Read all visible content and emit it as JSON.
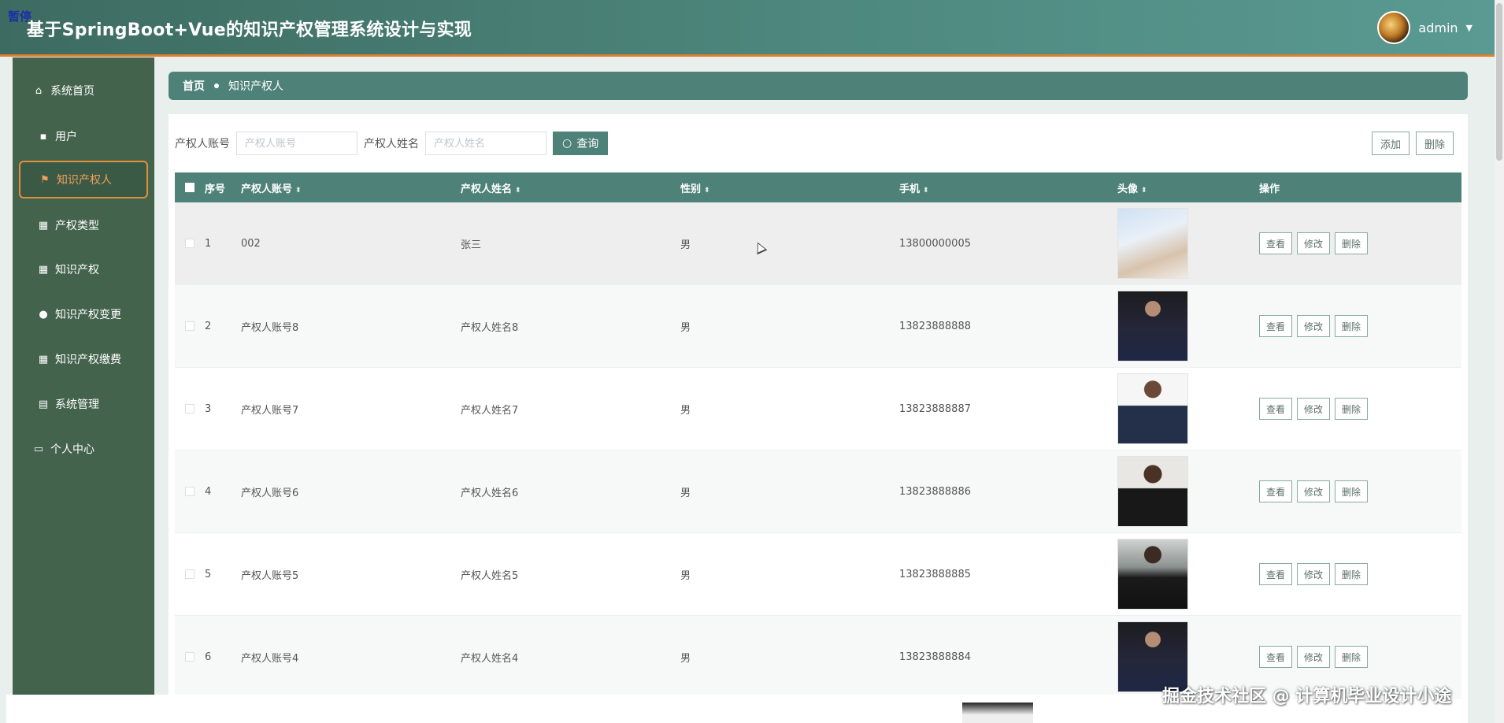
{
  "header": {
    "overlay": "暂停",
    "title": "基于SpringBoot+Vue的知识产权管理系统设计与实现",
    "user": "admin"
  },
  "sidebar": {
    "items": [
      {
        "label": "系统首页",
        "icon": "home-icon"
      },
      {
        "label": "用户",
        "icon": "chat-icon"
      },
      {
        "label": "知识产权人",
        "icon": "flag-icon"
      },
      {
        "label": "产权类型",
        "icon": "grid-icon"
      },
      {
        "label": "知识产权",
        "icon": "grid-icon"
      },
      {
        "label": "知识产权变更",
        "icon": "location-icon"
      },
      {
        "label": "知识产权缴费",
        "icon": "grid-icon"
      },
      {
        "label": "系统管理",
        "icon": "table-icon"
      },
      {
        "label": "个人中心",
        "icon": "calendar-icon"
      }
    ],
    "active_index": 2
  },
  "breadcrumb": {
    "home": "首页",
    "current": "知识产权人"
  },
  "search": {
    "account_label": "产权人账号",
    "account_placeholder": "产权人账号",
    "name_label": "产权人姓名",
    "name_placeholder": "产权人姓名",
    "search_button": "查询",
    "add_button": "添加",
    "delete_button": "删除"
  },
  "table": {
    "headers": {
      "index": "序号",
      "account": "产权人账号",
      "name": "产权人姓名",
      "gender": "性别",
      "phone": "手机",
      "photo": "头像",
      "actions": "操作"
    },
    "action_labels": {
      "view": "查看",
      "edit": "修改",
      "delete": "删除"
    },
    "rows": [
      {
        "index": "1",
        "account": "002",
        "name": "张三",
        "gender": "男",
        "phone": "13800000005"
      },
      {
        "index": "2",
        "account": "产权人账号8",
        "name": "产权人姓名8",
        "gender": "男",
        "phone": "13823888888"
      },
      {
        "index": "3",
        "account": "产权人账号7",
        "name": "产权人姓名7",
        "gender": "男",
        "phone": "13823888887"
      },
      {
        "index": "4",
        "account": "产权人账号6",
        "name": "产权人姓名6",
        "gender": "男",
        "phone": "13823888886"
      },
      {
        "index": "5",
        "account": "产权人账号5",
        "name": "产权人姓名5",
        "gender": "男",
        "phone": "13823888885"
      },
      {
        "index": "6",
        "account": "产权人账号4",
        "name": "产权人姓名4",
        "gender": "男",
        "phone": "13823888884"
      }
    ]
  },
  "watermark": "掘金技术社区 @ 计算机毕业设计小途",
  "colors": {
    "primary": "#4e8279",
    "sidebar": "#44634d",
    "active_border": "#e0913a",
    "header_underline": "#e07f2e"
  }
}
